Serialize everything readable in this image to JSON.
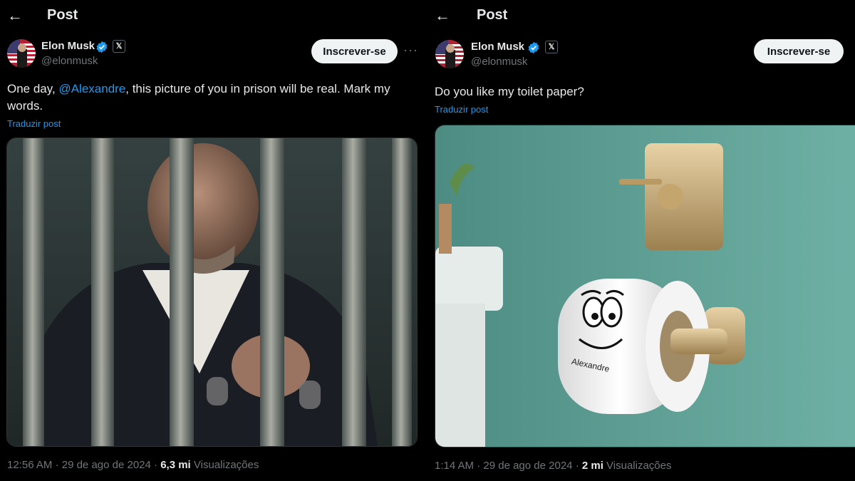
{
  "left_post": {
    "header_title": "Post",
    "author_name": "Elon Musk",
    "handle": "@elonmusk",
    "follow_label": "Inscrever-se",
    "more": "···",
    "text_before": "One day, ",
    "mention": "@Alexandre",
    "text_after": ", this picture of you in prison will be real. Mark my words.",
    "translate_label": "Traduzir post",
    "time": "12:56 AM",
    "dot1": "·",
    "date": "29 de ago de 2024",
    "dot2": "·",
    "views_count": "6,3 mi",
    "views_label": "Visualizações",
    "image_desc_icon": "prison-bars-photo"
  },
  "right_post": {
    "header_title": "Post",
    "author_name": "Elon Musk",
    "handle": "@elonmusk",
    "follow_label": "Inscrever-se",
    "text": "Do you like my toilet paper?",
    "translate_label": "Traduzir post",
    "time": "1:14 AM",
    "dot1": "·",
    "date": "29 de ago de 2024",
    "dot2": "·",
    "views_count": "2 mi",
    "views_label": "Visualizações",
    "roll_label": "Alexandre"
  },
  "colors": {
    "background": "#000000",
    "text": "#e7e9ea",
    "muted": "#71767b",
    "accent": "#1d9bf0",
    "follow_bg": "#eff3f4"
  },
  "icons": [
    "back-arrow-icon",
    "verified-badge-icon",
    "x-affiliate-icon",
    "more-icon"
  ]
}
